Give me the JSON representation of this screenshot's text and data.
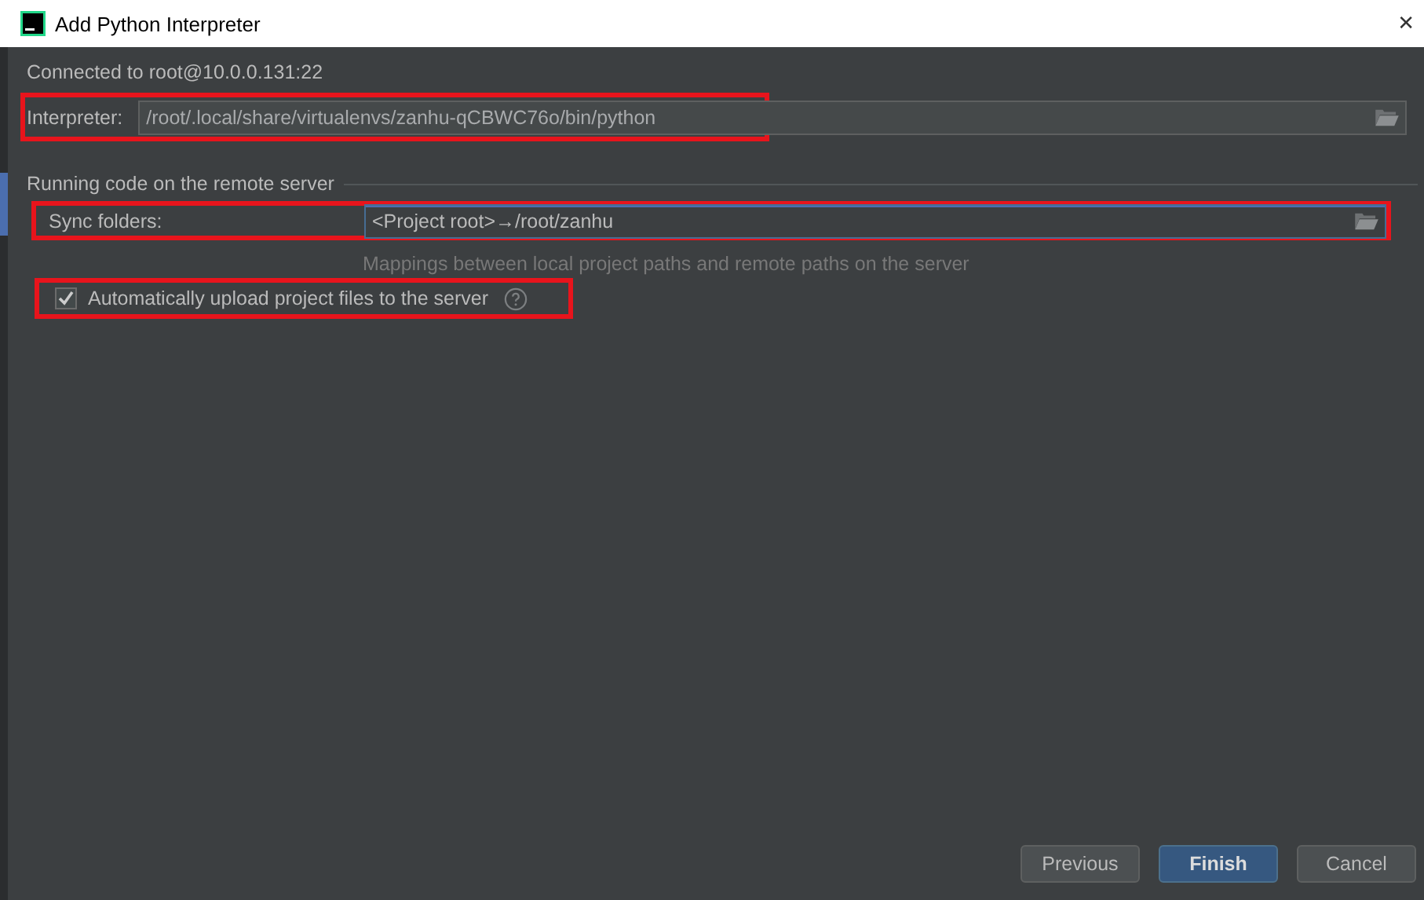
{
  "window": {
    "title": "Add Python Interpreter",
    "close": "✕"
  },
  "connection": "Connected to root@10.0.0.131:22",
  "interpreter": {
    "label": "Interpreter:",
    "value": "/root/.local/share/virtualenvs/zanhu-qCBWC76o/bin/python",
    "highlighted": true,
    "disabled": true
  },
  "section": {
    "title": "Running code on the remote server"
  },
  "sync": {
    "label": "Sync folders:",
    "value": "<Project root>→/root/zanhu",
    "hint": "Mappings between local project paths and remote paths on the server",
    "highlighted": true,
    "focused": true
  },
  "auto_upload": {
    "label": "Automatically upload project files to the server",
    "checked": true,
    "highlighted": true
  },
  "buttons": [
    {
      "label": "Previous",
      "kind": "normal"
    },
    {
      "label": "Finish",
      "kind": "primary"
    },
    {
      "label": "Cancel",
      "kind": "normal"
    }
  ]
}
